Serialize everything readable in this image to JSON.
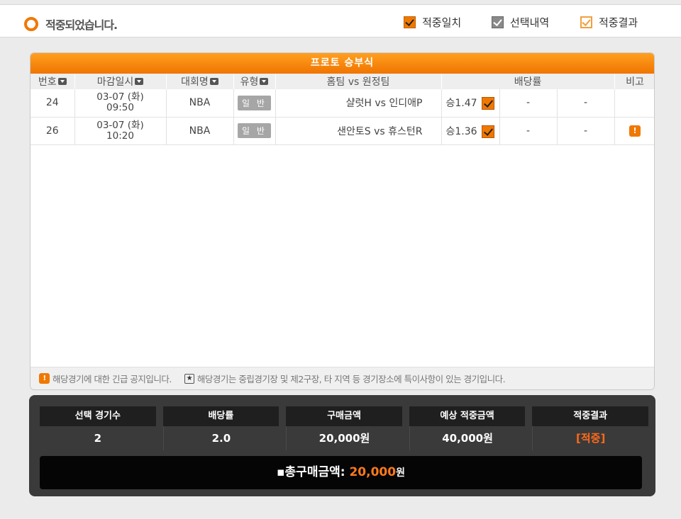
{
  "status": {
    "text": "적중되었습니다."
  },
  "legend": [
    {
      "label": "적중일치",
      "style": "orange"
    },
    {
      "label": "선택내역",
      "style": "gray"
    },
    {
      "label": "적중결과",
      "style": "outline"
    }
  ],
  "panel": {
    "title": "프로토 승부식"
  },
  "table": {
    "headers": [
      "번호",
      "마감일시",
      "대회명",
      "유형",
      "홈팀 vs 원정팀",
      "배당률",
      "비고"
    ],
    "rows": [
      {
        "no": "24",
        "date": "03-07 (화)",
        "time": "09:50",
        "league": "NBA",
        "type": "일 반",
        "match": "샬럿H vs 인디애P",
        "odds": "승1.47",
        "draw": "-",
        "away": "-",
        "note": ""
      },
      {
        "no": "26",
        "date": "03-07 (화)",
        "time": "10:20",
        "league": "NBA",
        "type": "일 반",
        "match": "샌안토S vs 휴스턴R",
        "odds": "승1.36",
        "draw": "-",
        "away": "-",
        "note": "!"
      }
    ]
  },
  "footnote": {
    "warn_glyph": "!",
    "urgent": "해당경기에 대한 긴급 공지입니다.",
    "star_glyph": "★",
    "neutral": "해당경기는 중립경기장 및 제2구장, 타 지역 등 경기장소에 특이사항이 있는 경기입니다."
  },
  "summary": {
    "columns": [
      {
        "label": "선택 경기수",
        "value": "2"
      },
      {
        "label": "배당률",
        "value": "2.0"
      },
      {
        "label": "구매금액",
        "value": "20,000원"
      },
      {
        "label": "예상 적중금액",
        "value": "40,000원"
      },
      {
        "label": "적중결과",
        "value": "[적중]"
      }
    ],
    "total_label": "▪총구매금액:",
    "total_amount": "20,000",
    "total_unit": "원"
  },
  "colors": {
    "accent": "#f07800",
    "hit": "#ff6a1a",
    "dark": "#3a3a3a"
  }
}
